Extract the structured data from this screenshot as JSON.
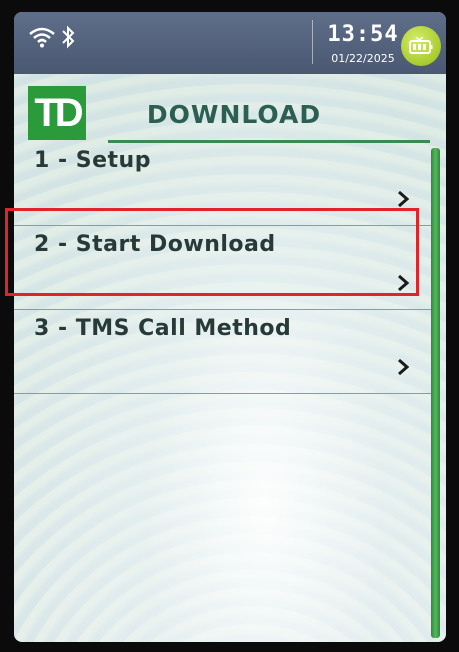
{
  "status_bar": {
    "time": "13:54",
    "date": "01/22/2025",
    "icons": [
      "wifi-icon",
      "bluetooth-icon",
      "battery-icon"
    ]
  },
  "header": {
    "logo_text": "TD",
    "title": "DOWNLOAD"
  },
  "menu": {
    "items": [
      {
        "label": "1 - Setup"
      },
      {
        "label": "2 - Start Download"
      },
      {
        "label": "3 - TMS Call Method"
      }
    ]
  },
  "colors": {
    "accent": "#2a9a3a",
    "highlight": "#e0242a",
    "status_bar": "#56647e"
  }
}
